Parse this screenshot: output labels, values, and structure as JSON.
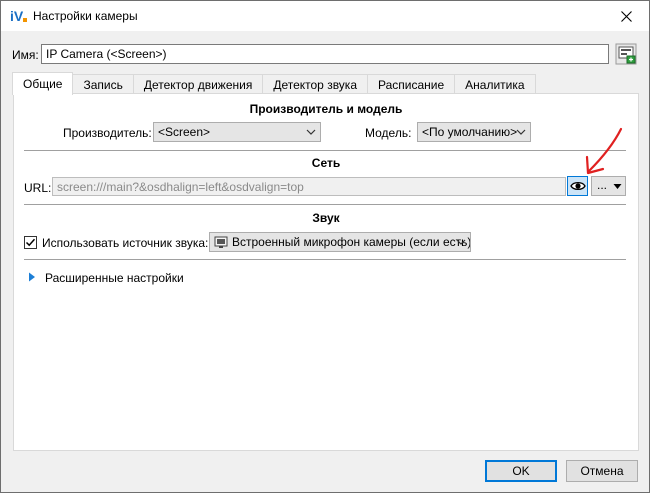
{
  "window": {
    "title": "Настройки камеры",
    "logo_text": "iV"
  },
  "name_row": {
    "label": "Имя:",
    "value": "IP Camera (<Screen>)"
  },
  "tabs": [
    {
      "label": "Общие",
      "active": true
    },
    {
      "label": "Запись",
      "active": false
    },
    {
      "label": "Детектор движения",
      "active": false
    },
    {
      "label": "Детектор звука",
      "active": false
    },
    {
      "label": "Расписание",
      "active": false
    },
    {
      "label": "Аналитика",
      "active": false
    }
  ],
  "manufacturer_section": {
    "title": "Производитель и модель",
    "manufacturer_label": "Производитель:",
    "manufacturer_value": "<Screen>",
    "model_label": "Модель:",
    "model_value": "<По умолчанию>"
  },
  "network_section": {
    "title": "Сеть",
    "url_label": "URL:",
    "url_value": "screen:///main?&osdhalign=left&osdvalign=top",
    "more_label": "..."
  },
  "sound_section": {
    "title": "Звук",
    "use_source_label": "Использовать источник звука:",
    "use_source_checked": true,
    "source_value": "Встроенный микрофон камеры (если есть)"
  },
  "advanced": {
    "label": "Расширенные настройки"
  },
  "footer": {
    "ok_label": "OK",
    "cancel_label": "Отмена"
  },
  "colors": {
    "accent": "#0078d7",
    "annotation_arrow": "#e02020"
  }
}
